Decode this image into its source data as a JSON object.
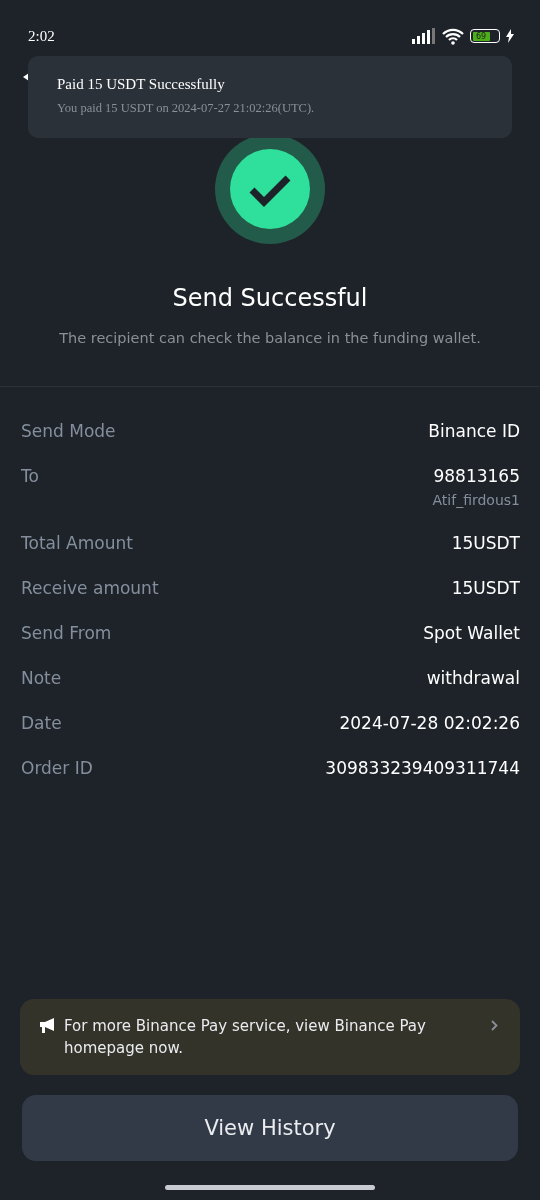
{
  "status_bar": {
    "time": "2:02",
    "battery": "69"
  },
  "toast": {
    "title": "Paid 15 USDT Successfully",
    "message": "You paid 15 USDT on 2024-07-27 21:02:26(UTC)."
  },
  "result": {
    "title": "Send Successful",
    "subtitle": "The recipient can check the balance in the funding wallet."
  },
  "details": [
    {
      "label": "Send Mode",
      "value": "Binance ID"
    },
    {
      "label": "To",
      "value": "98813165",
      "sub": "Atif_firdous1"
    },
    {
      "label": "Total Amount",
      "value": "15USDT"
    },
    {
      "label": "Receive amount",
      "value": "15USDT"
    },
    {
      "label": "Send From",
      "value": "Spot Wallet"
    },
    {
      "label": "Note",
      "value": "withdrawal"
    },
    {
      "label": "Date",
      "value": "2024-07-28 02:02:26"
    },
    {
      "label": "Order ID",
      "value": "309833239409311744"
    }
  ],
  "banner": {
    "text": "For more Binance Pay service, view Binance Pay homepage now."
  },
  "button": "View History"
}
